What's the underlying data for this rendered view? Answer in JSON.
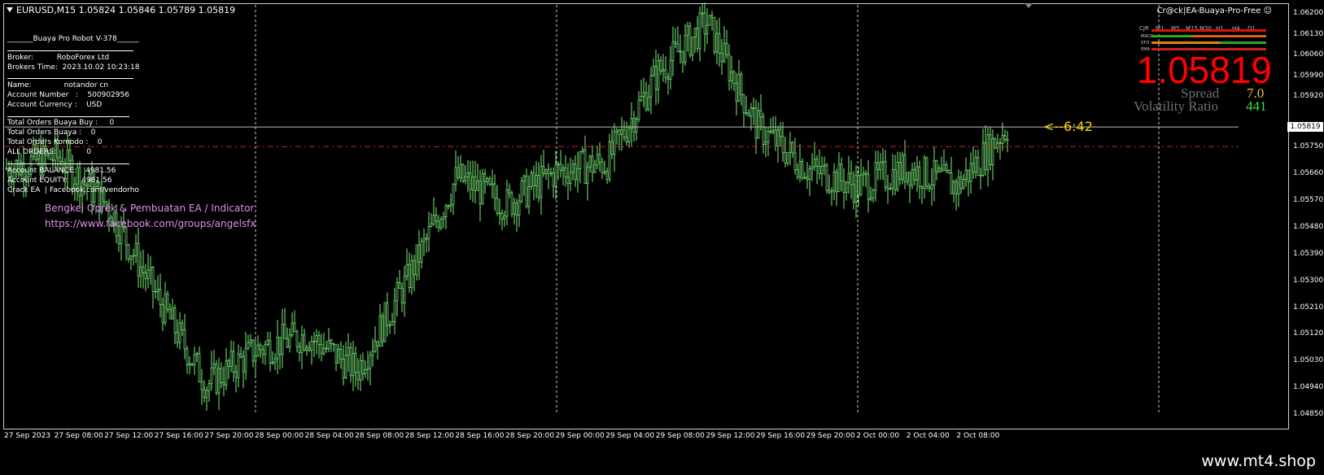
{
  "header": {
    "symbol_line": "EURUSD,M15  1.05824 1.05846 1.05789 1.05819",
    "ea_name": "Cr@ck|EA-Buaya-Pro-Free"
  },
  "info_panel": {
    "robot_title": "_______Buaya Pro Robot V-378______",
    "broker": "Broker:          RoboForex Ltd",
    "brokers_time": "Brokers Time:  2023.10.02 10:23:18",
    "name": "Name:              notandor cn",
    "account_number": "Account Number   :    500902956",
    "account_currency": "Account Currency :    USD",
    "orders_line_1": "Total Orders Buaya Buy :     0",
    "orders_line_2": "Total Orders Buaya :    0",
    "orders_komodo": "Total Orders Komodo :    0",
    "all_orders": "ALL ORDERS:             0",
    "balance": "Account BALANCE:    4981.56",
    "equity": "Account EQUITY:      4981.56",
    "crack": "Crack EA  | Facebook.com/vendorho"
  },
  "promo": {
    "line1": "Bengkel Oprek & Pembuatan EA / Indicator",
    "line2": "https://www.facebook.com/groups/angelsfx"
  },
  "right_panel": {
    "big_price": "1.05819",
    "spread_label": "Spread",
    "spread_value": "7.0",
    "volatility_label": "Volatility Ratio",
    "volatility_value": "441",
    "timeframes": [
      "CJR",
      "M1",
      "M5",
      "M15",
      "M30",
      "H1",
      "H4",
      "D1"
    ],
    "indicators": [
      "MACD",
      "STO",
      "EMA"
    ]
  },
  "timer": "<--6:42",
  "price_axis": {
    "labels": [
      "1.06200",
      "1.06130",
      "1.06060",
      "1.05990",
      "1.05920",
      "1.05819",
      "1.05750",
      "1.05660",
      "1.05570",
      "1.05480",
      "1.05390",
      "1.05300",
      "1.05210",
      "1.05120",
      "1.05030",
      "1.04940",
      "1.04850"
    ],
    "current": "1.05819"
  },
  "time_axis": [
    "27 Sep 2023",
    "27 Sep 08:00",
    "27 Sep 12:00",
    "27 Sep 16:00",
    "27 Sep 20:00",
    "28 Sep 00:00",
    "28 Sep 04:00",
    "28 Sep 08:00",
    "28 Sep 12:00",
    "28 Sep 16:00",
    "28 Sep 20:00",
    "29 Sep 00:00",
    "29 Sep 04:00",
    "29 Sep 08:00",
    "29 Sep 12:00",
    "29 Sep 16:00",
    "29 Sep 20:00",
    "2 Oct 00:00",
    "2 Oct 04:00",
    "2 Oct 08:00"
  ],
  "watermark": "www.mt4.shop",
  "colors": {
    "candle": "#7cf07c",
    "bid_line": "#bfbfbf",
    "dash_line": "#d02020",
    "background": "#000000"
  },
  "chart_data": {
    "type": "line",
    "x": [
      "27 Sep 2023",
      "27 Sep 08:00",
      "27 Sep 12:00",
      "27 Sep 16:00",
      "27 Sep 20:00",
      "28 Sep 00:00",
      "28 Sep 04:00",
      "28 Sep 08:00",
      "28 Sep 12:00",
      "28 Sep 16:00",
      "28 Sep 20:00",
      "29 Sep 00:00",
      "29 Sep 04:00",
      "29 Sep 08:00",
      "29 Sep 12:00",
      "29 Sep 16:00",
      "29 Sep 20:00",
      "2 Oct 00:00",
      "2 Oct 04:00",
      "2 Oct 08:00",
      "2 Oct 10:15"
    ],
    "series": [
      {
        "values": [
          1.0568,
          1.0572,
          1.0556,
          1.0525,
          1.0495,
          1.0507,
          1.0512,
          1.05,
          1.053,
          1.0565,
          1.0556,
          1.0567,
          1.057,
          1.06,
          1.0617,
          1.0582,
          1.0568,
          1.0562,
          1.0568,
          1.0562,
          1.0582
        ]
      }
    ],
    "ylim": [
      1.0485,
      1.0623
    ],
    "grid": false
  }
}
